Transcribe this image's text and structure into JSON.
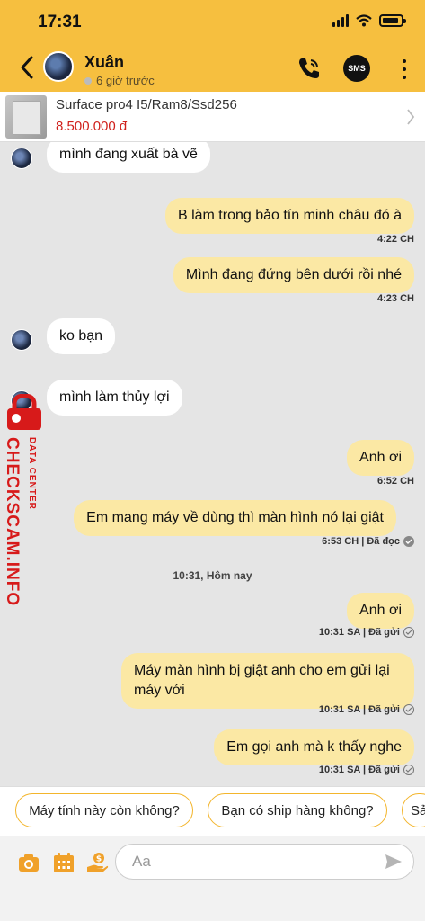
{
  "status": {
    "time": "17:31"
  },
  "header": {
    "name": "Xuân",
    "presence": "6 giờ trước",
    "sms_label": "SMS"
  },
  "product": {
    "title": "Surface pro4 I5/Ram8/Ssd256",
    "price": "8.500.000 đ"
  },
  "messages": [
    {
      "side": "in",
      "text": "mình đang xuất bà vẽ"
    },
    {
      "side": "out",
      "text": "B làm trong bảo tín minh châu đó à",
      "time": "4:22 CH"
    },
    {
      "side": "out",
      "text": "Mình đang đứng bên dưới rồi nhé",
      "time": "4:23 CH"
    },
    {
      "side": "in",
      "text": "ko bạn"
    },
    {
      "side": "in",
      "text": "mình làm thủy lợi"
    },
    {
      "side": "out",
      "text": "Anh ơi",
      "time": "6:52 CH"
    },
    {
      "side": "out",
      "text": "Em mang máy về dùng thì màn hình nó lại giật",
      "time": "6:53 CH | Đã đọc"
    },
    {
      "side": "out",
      "text": "Anh ơi",
      "time": "10:31 SA | Đã gửi"
    },
    {
      "side": "out",
      "text_line1": "Máy màn hình bị giật anh cho em gửi lại",
      "text_line2": "máy với",
      "time": "10:31 SA | Đã gửi"
    },
    {
      "side": "out",
      "text": "Em gọi anh mà k thấy nghe",
      "time": "10:31 SA | Đã gửi"
    }
  ],
  "day_divider": "10:31, Hôm nay",
  "watermark": {
    "main": "CHECKSCAM.INFO",
    "sub": "DATA CENTER"
  },
  "suggestions": [
    "Máy tính này còn không?",
    "Bạn có ship hàng không?",
    "Sả"
  ],
  "composer": {
    "placeholder": "Aa"
  },
  "colors": {
    "header": "#f6bf3f",
    "outgoing_bubble": "#fbe8a4",
    "price": "#d0211c",
    "accent_tools": "#f0a12a",
    "watermark": "#d71a1a"
  }
}
